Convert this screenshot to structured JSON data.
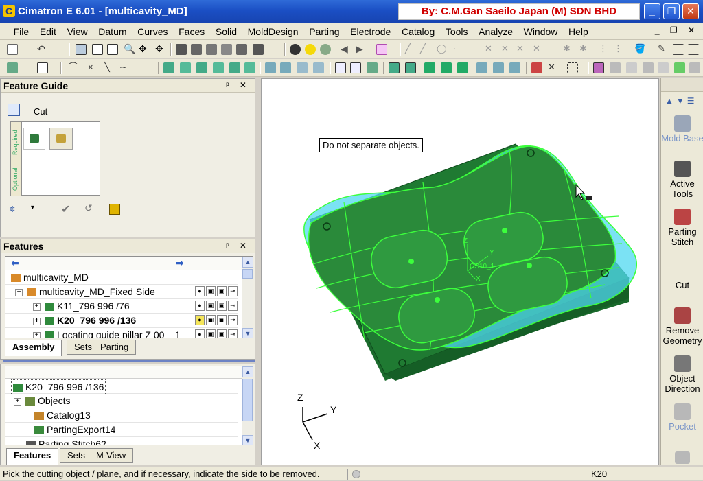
{
  "window": {
    "title": "Cimatron E 6.01 - [multicavity_MD]",
    "credit": "By: C.M.Gan Saeilo Japan (M) SDN BHD"
  },
  "menu": [
    "File",
    "Edit",
    "View",
    "Datum",
    "Curves",
    "Faces",
    "Solid",
    "MoldDesign",
    "Parting",
    "Electrode",
    "Catalog",
    "Tools",
    "Analyze",
    "Window",
    "Help"
  ],
  "feature_guide": {
    "title": "Feature Guide",
    "command": "Cut",
    "required_label": "Required",
    "optional_label": "Optional"
  },
  "features_panel": {
    "title": "Features",
    "rows": [
      {
        "label": "multicavity_MD",
        "bold": false
      },
      {
        "label": "multicavity_MD_Fixed Side",
        "bold": false
      },
      {
        "label": "K11_796 996 /76",
        "bold": false
      },
      {
        "label": "K20_796 996 /136",
        "bold": true
      },
      {
        "label": "Locating guide pillar Z 00 _ 1",
        "bold": false
      }
    ],
    "tabs": [
      "Assembly",
      "Sets",
      "Parting"
    ]
  },
  "lower_tree": {
    "rows": [
      {
        "label": "K20_796 996 /136"
      },
      {
        "label": "Objects"
      },
      {
        "label": "Catalog13"
      },
      {
        "label": "PartingExport14"
      },
      {
        "label": "Parting Stitch62"
      }
    ],
    "tabs": [
      "Features",
      "Sets",
      "M-View"
    ]
  },
  "viewport": {
    "tooltip": "Do not separate objects.",
    "axis_labels": {
      "z": "Z",
      "y": "Y",
      "x": "X"
    },
    "part_label": "CS10_1",
    "model_axes": {
      "z": "Z",
      "y": "Y",
      "x": "X"
    }
  },
  "right_strip": [
    {
      "label": "Mold Base",
      "enabled": false
    },
    {
      "label": "Active Tools",
      "enabled": true
    },
    {
      "label": "Parting Stitch",
      "enabled": true
    },
    {
      "label": "Cut",
      "enabled": true
    },
    {
      "label": "Remove Geometry",
      "enabled": true
    },
    {
      "label": "Object Direction",
      "enabled": true
    },
    {
      "label": "Pocket",
      "enabled": false
    }
  ],
  "status": {
    "prompt": "Pick the cutting object / plane, and if necessary, indicate the side to be removed.",
    "right_value": "K20"
  },
  "colors": {
    "title_blue": "#1b4fc4",
    "credit_red": "#d00000",
    "mold_green": "#1f7a32",
    "surface_cyan": "#4fd8f0",
    "edge_green": "#3cff3c"
  }
}
